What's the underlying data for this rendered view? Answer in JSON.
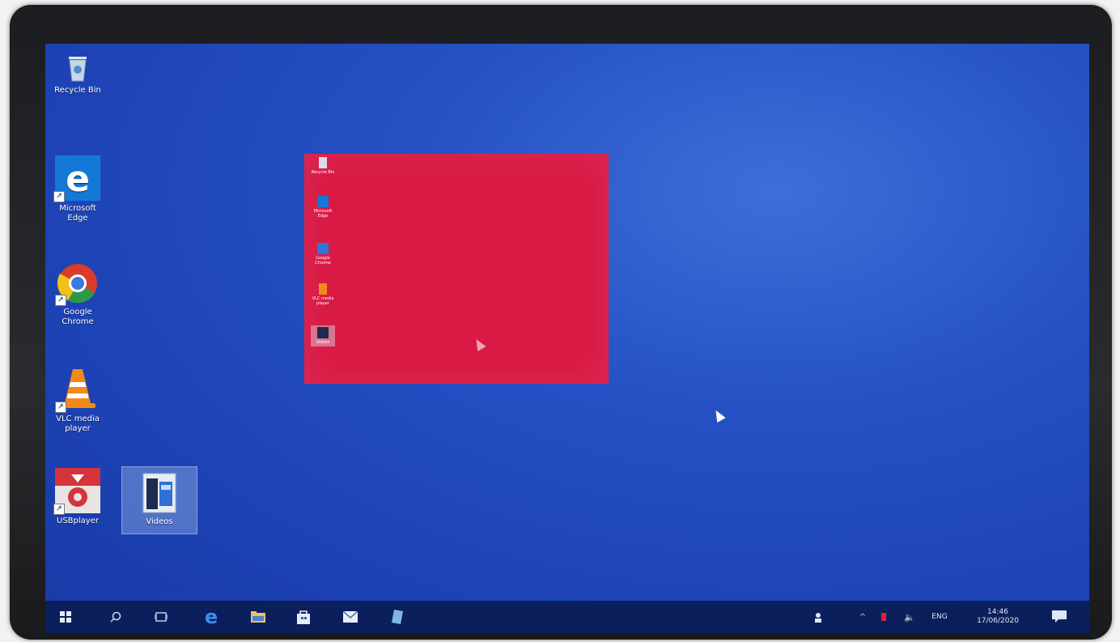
{
  "desktop_icons": [
    {
      "name": "recycle-bin",
      "label": "Recycle Bin"
    },
    {
      "name": "microsoft-edge",
      "label": "Microsoft Edge"
    },
    {
      "name": "google-chrome",
      "label": "Google Chrome"
    },
    {
      "name": "vlc-media-player",
      "label": "VLC media player"
    },
    {
      "name": "usbplayer",
      "label": "USBplayer"
    },
    {
      "name": "videos",
      "label": "Videos"
    }
  ],
  "taskbar": {
    "language": "ENG",
    "time": "14:46",
    "date": "17/06/2020"
  },
  "colors": {
    "desktop": "#1d43b6",
    "preview_window": "#d91a45",
    "taskbar": "#0b1f5c"
  }
}
